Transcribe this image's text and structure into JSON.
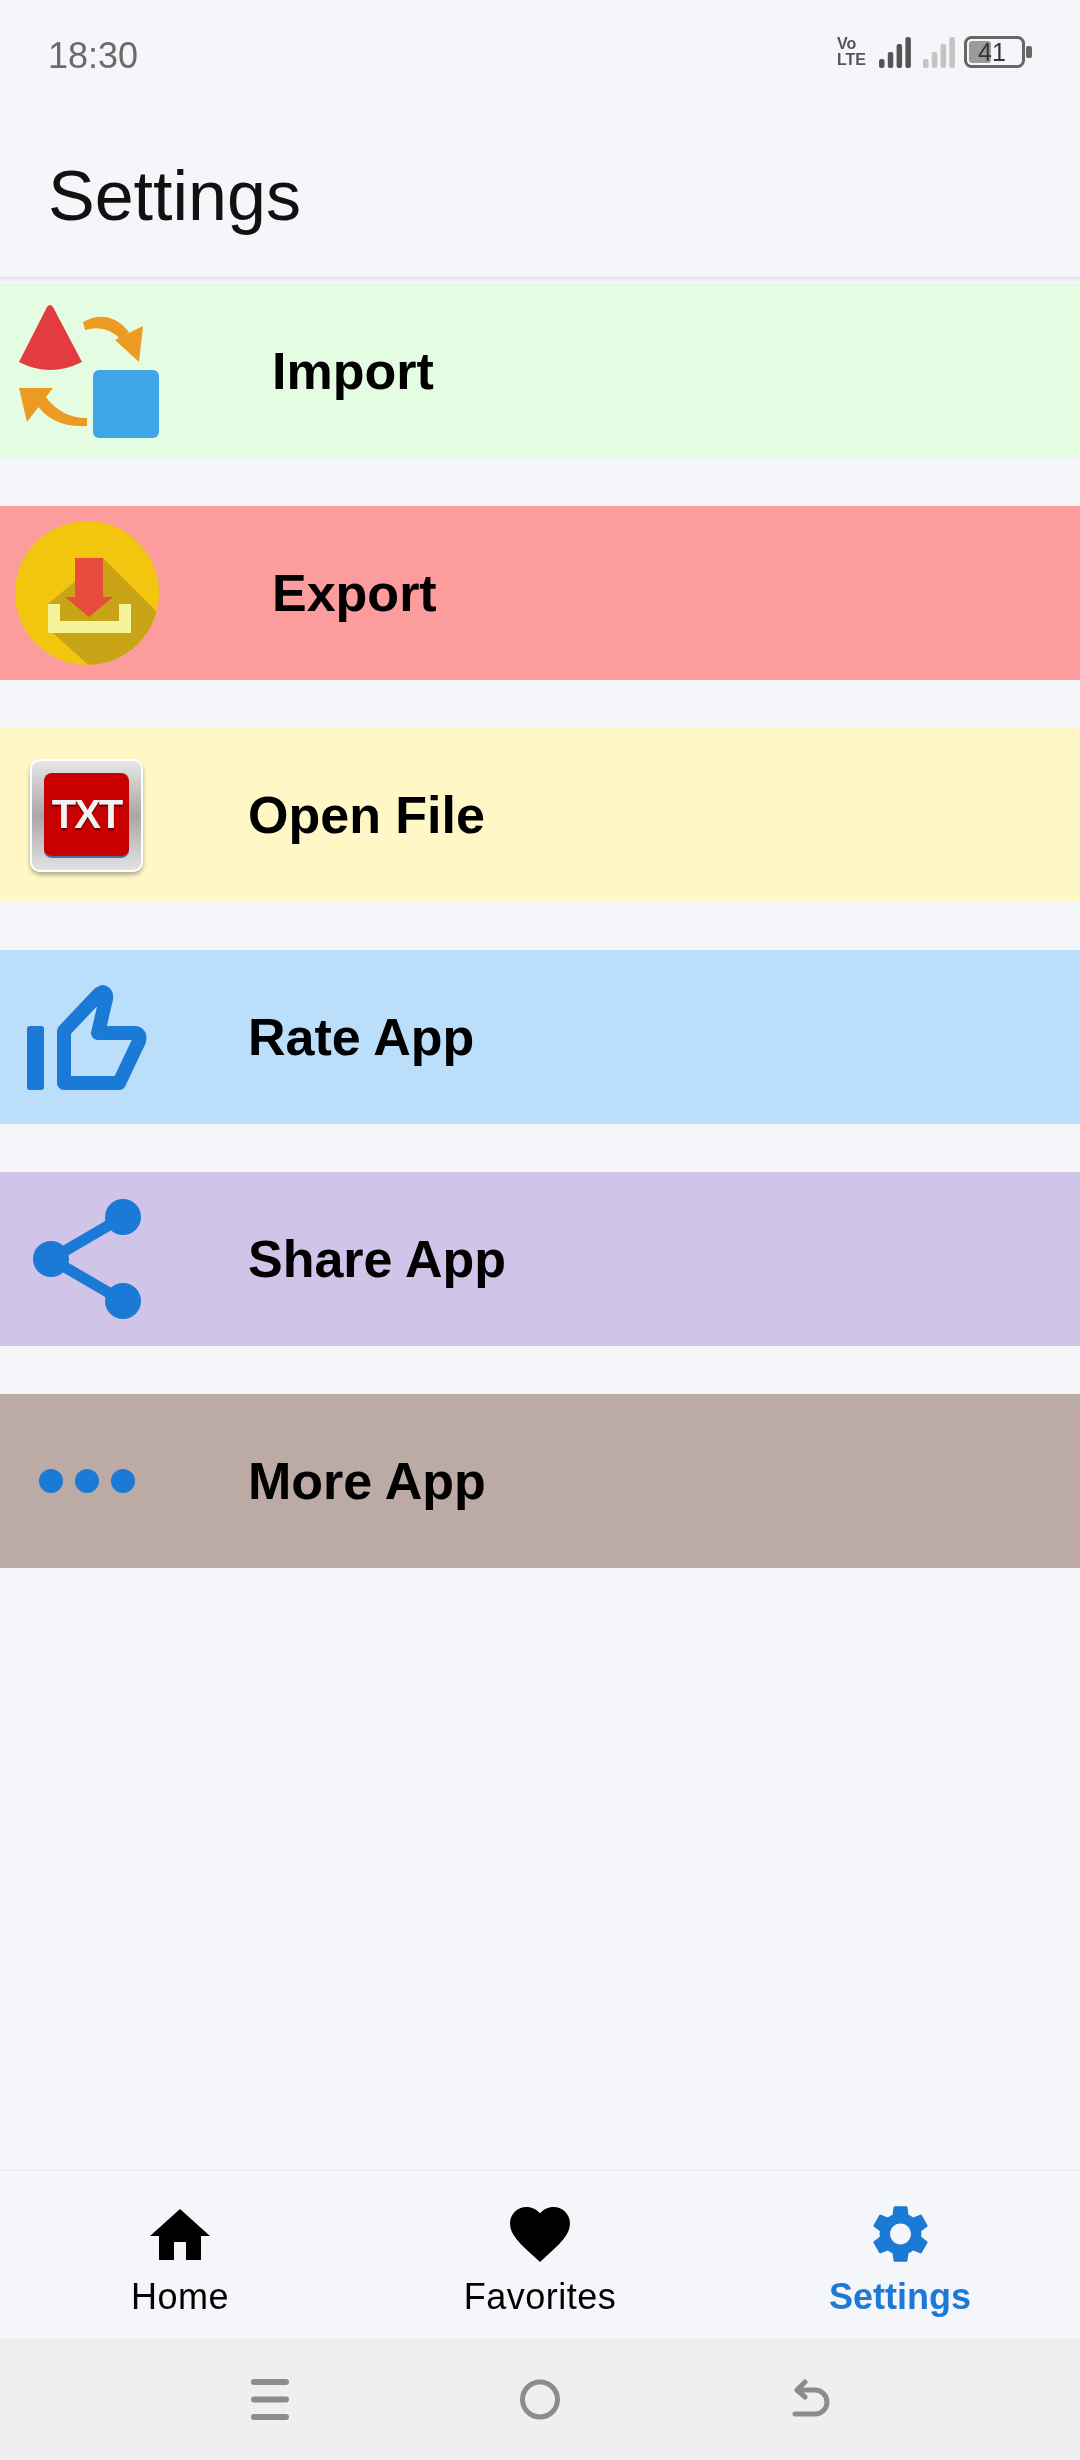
{
  "status_bar": {
    "time": "18:30",
    "network_type": [
      "Vo",
      "LTE"
    ],
    "battery": "41"
  },
  "header": {
    "title": "Settings"
  },
  "rows": [
    {
      "label": "Import",
      "color": "#e4fde2"
    },
    {
      "label": "Export",
      "color": "#fc9c9c"
    },
    {
      "label": "Open File",
      "color": "#fff8c6",
      "icon_text": "TXT"
    },
    {
      "label": "Rate App",
      "color": "#bbdefa"
    },
    {
      "label": "Share App",
      "color": "#d1c4e9"
    },
    {
      "label": "More App",
      "color": "#bcaaa4"
    }
  ],
  "nav": {
    "items": [
      {
        "label": "Home",
        "selected": false
      },
      {
        "label": "Favorites",
        "selected": false
      },
      {
        "label": "Settings",
        "selected": true
      }
    ]
  }
}
